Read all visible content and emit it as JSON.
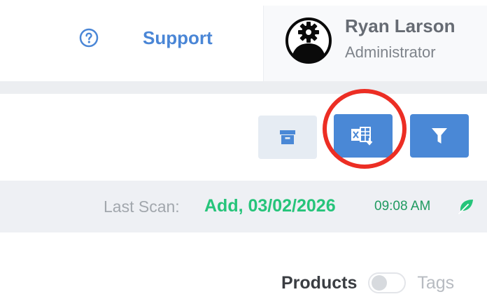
{
  "header": {
    "support": {
      "label": "Support",
      "icon": "help-circle-icon"
    },
    "user": {
      "name": "Ryan Larson",
      "role": "Administrator",
      "avatar_icon": "user-gear-avatar-icon"
    }
  },
  "toolbar": {
    "buttons": [
      {
        "name": "archive",
        "icon": "archive-box-icon"
      },
      {
        "name": "export-excel",
        "icon": "excel-download-icon",
        "highlighted": true
      },
      {
        "name": "filter",
        "icon": "funnel-icon"
      }
    ]
  },
  "scan": {
    "label": "Last Scan:",
    "date": "Add, 03/02/2026",
    "time": "09:08 AM",
    "icon": "leaf-icon"
  },
  "view_toggle": {
    "left_label": "Products",
    "right_label": "Tags",
    "state": "off"
  },
  "colors": {
    "accent": "#4a88d6",
    "link": "#4a86d6",
    "success": "#26c47a",
    "highlight": "#ec2e24"
  }
}
